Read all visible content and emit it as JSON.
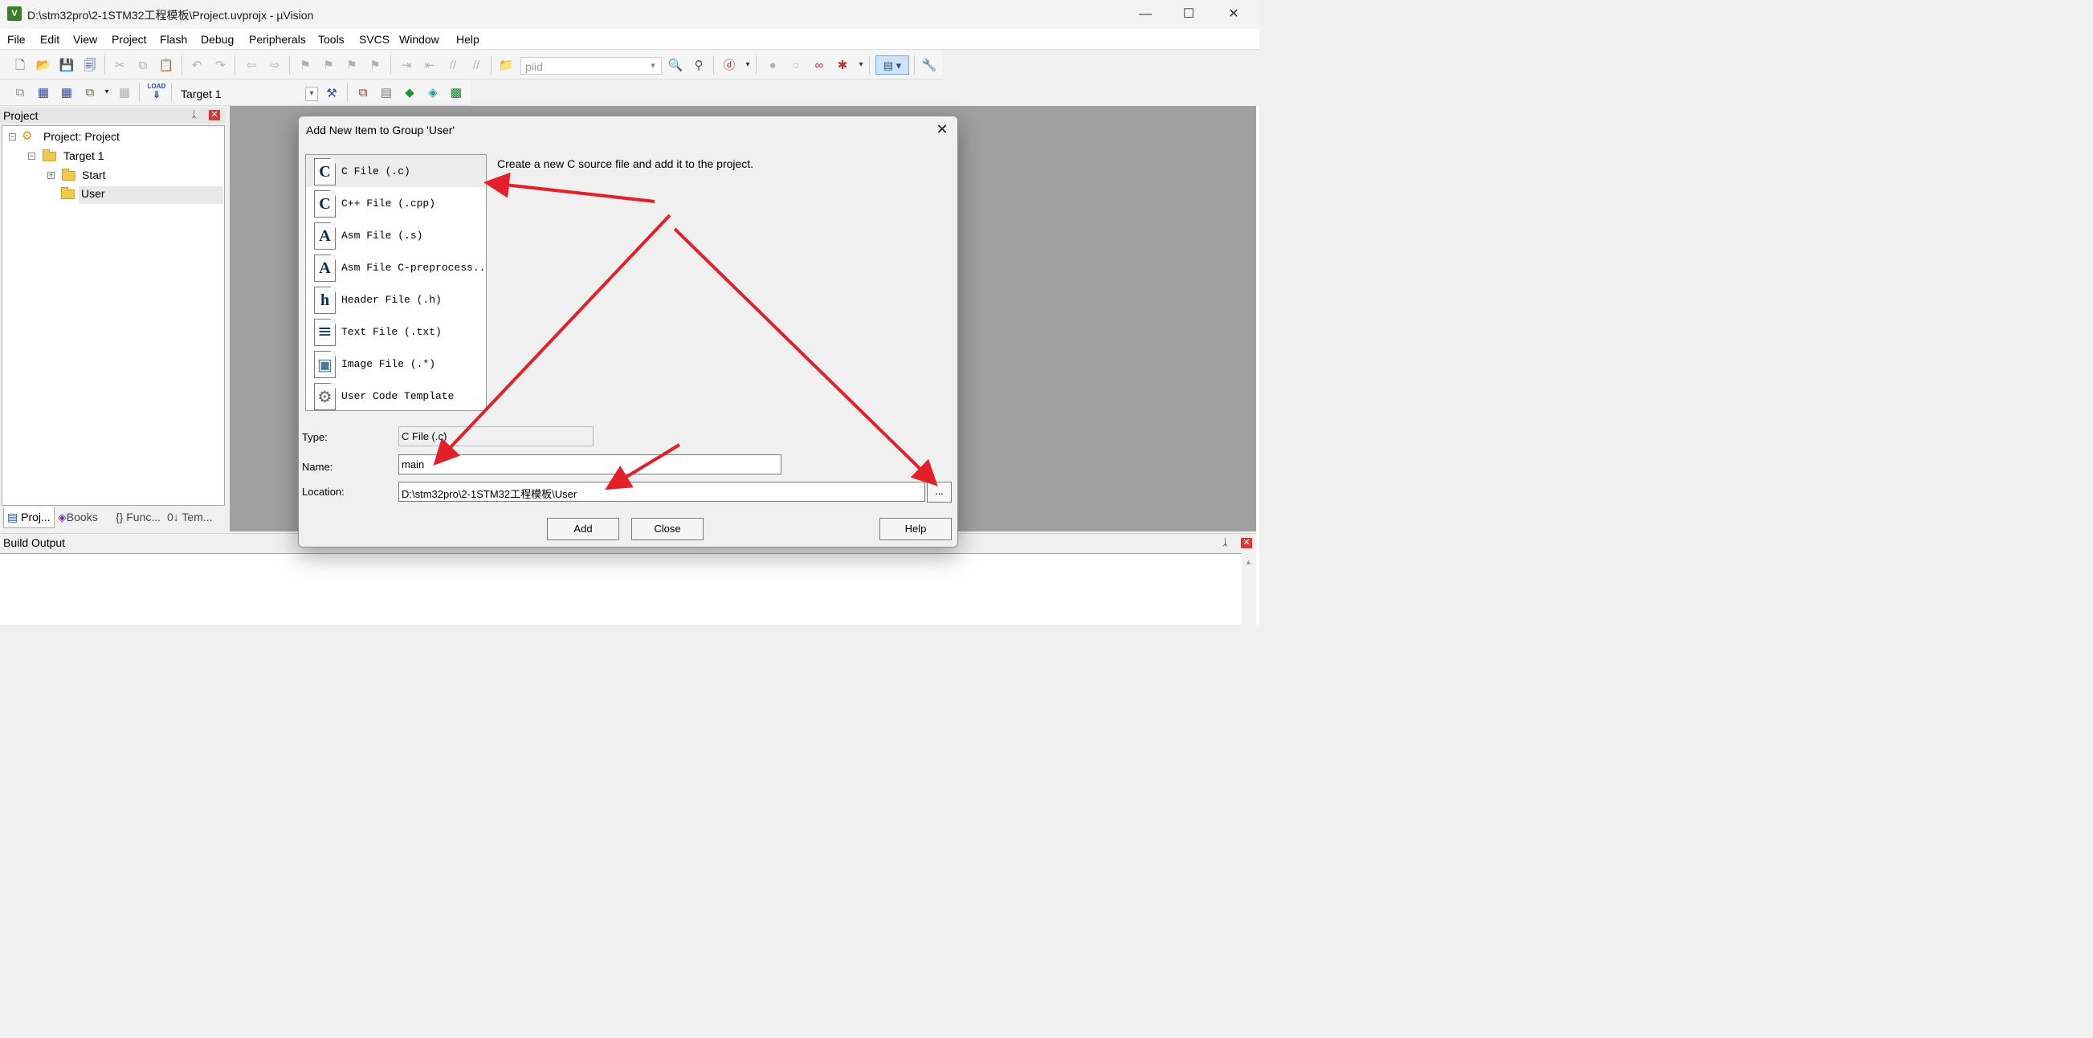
{
  "window": {
    "title": "D:\\stm32pro\\2-1STM32工程模板\\Project.uvprojx - µVision",
    "app_icon": "V",
    "minimize": "—",
    "maximize": "☐",
    "close": "✕"
  },
  "menu": [
    "File",
    "Edit",
    "View",
    "Project",
    "Flash",
    "Debug",
    "Peripherals",
    "Tools",
    "SVCS",
    "Window",
    "Help"
  ],
  "toolbar": {
    "find_value": "piid",
    "target_value": "Target 1",
    "load_label": "LOAD"
  },
  "project_panel": {
    "title": "Project",
    "pin": "ᛣ",
    "close": "✕",
    "tree": {
      "root": "Project: Project",
      "target": "Target 1",
      "groups": [
        "Start",
        "User"
      ]
    },
    "tabs": [
      "Proj...",
      "Books",
      "{} Func...",
      "0↓ Tem..."
    ]
  },
  "build_output": {
    "title": "Build Output"
  },
  "dialog": {
    "title": "Add New Item to Group 'User'",
    "close": "✕",
    "description": "Create a new C source file and add it to the project.",
    "items": [
      {
        "icon": "C",
        "label": "C File (.c)"
      },
      {
        "icon": "C",
        "label": "C++ File (.cpp)"
      },
      {
        "icon": "A",
        "label": "Asm File (.s)"
      },
      {
        "icon": "A",
        "label": "Asm File C-preprocess..."
      },
      {
        "icon": "h",
        "label": "Header File (.h)"
      },
      {
        "icon": "≡",
        "label": "Text File (.txt)"
      },
      {
        "icon": "▣",
        "label": "Image File (.*)"
      },
      {
        "icon": "⚙",
        "label": "User Code Template"
      }
    ],
    "type_label": "Type:",
    "type_value": "C File (.c)",
    "name_label": "Name:",
    "name_value": "main",
    "location_label": "Location:",
    "location_value": "D:\\stm32pro\\2-1STM32工程模板\\User",
    "browse_label": "...",
    "add_label": "Add",
    "close_label": "Close",
    "help_label": "Help"
  },
  "colors": {
    "annotation_arrow": "#e3202a",
    "workspace": "#a0a0a0",
    "close_badge": "#d63a3a"
  }
}
